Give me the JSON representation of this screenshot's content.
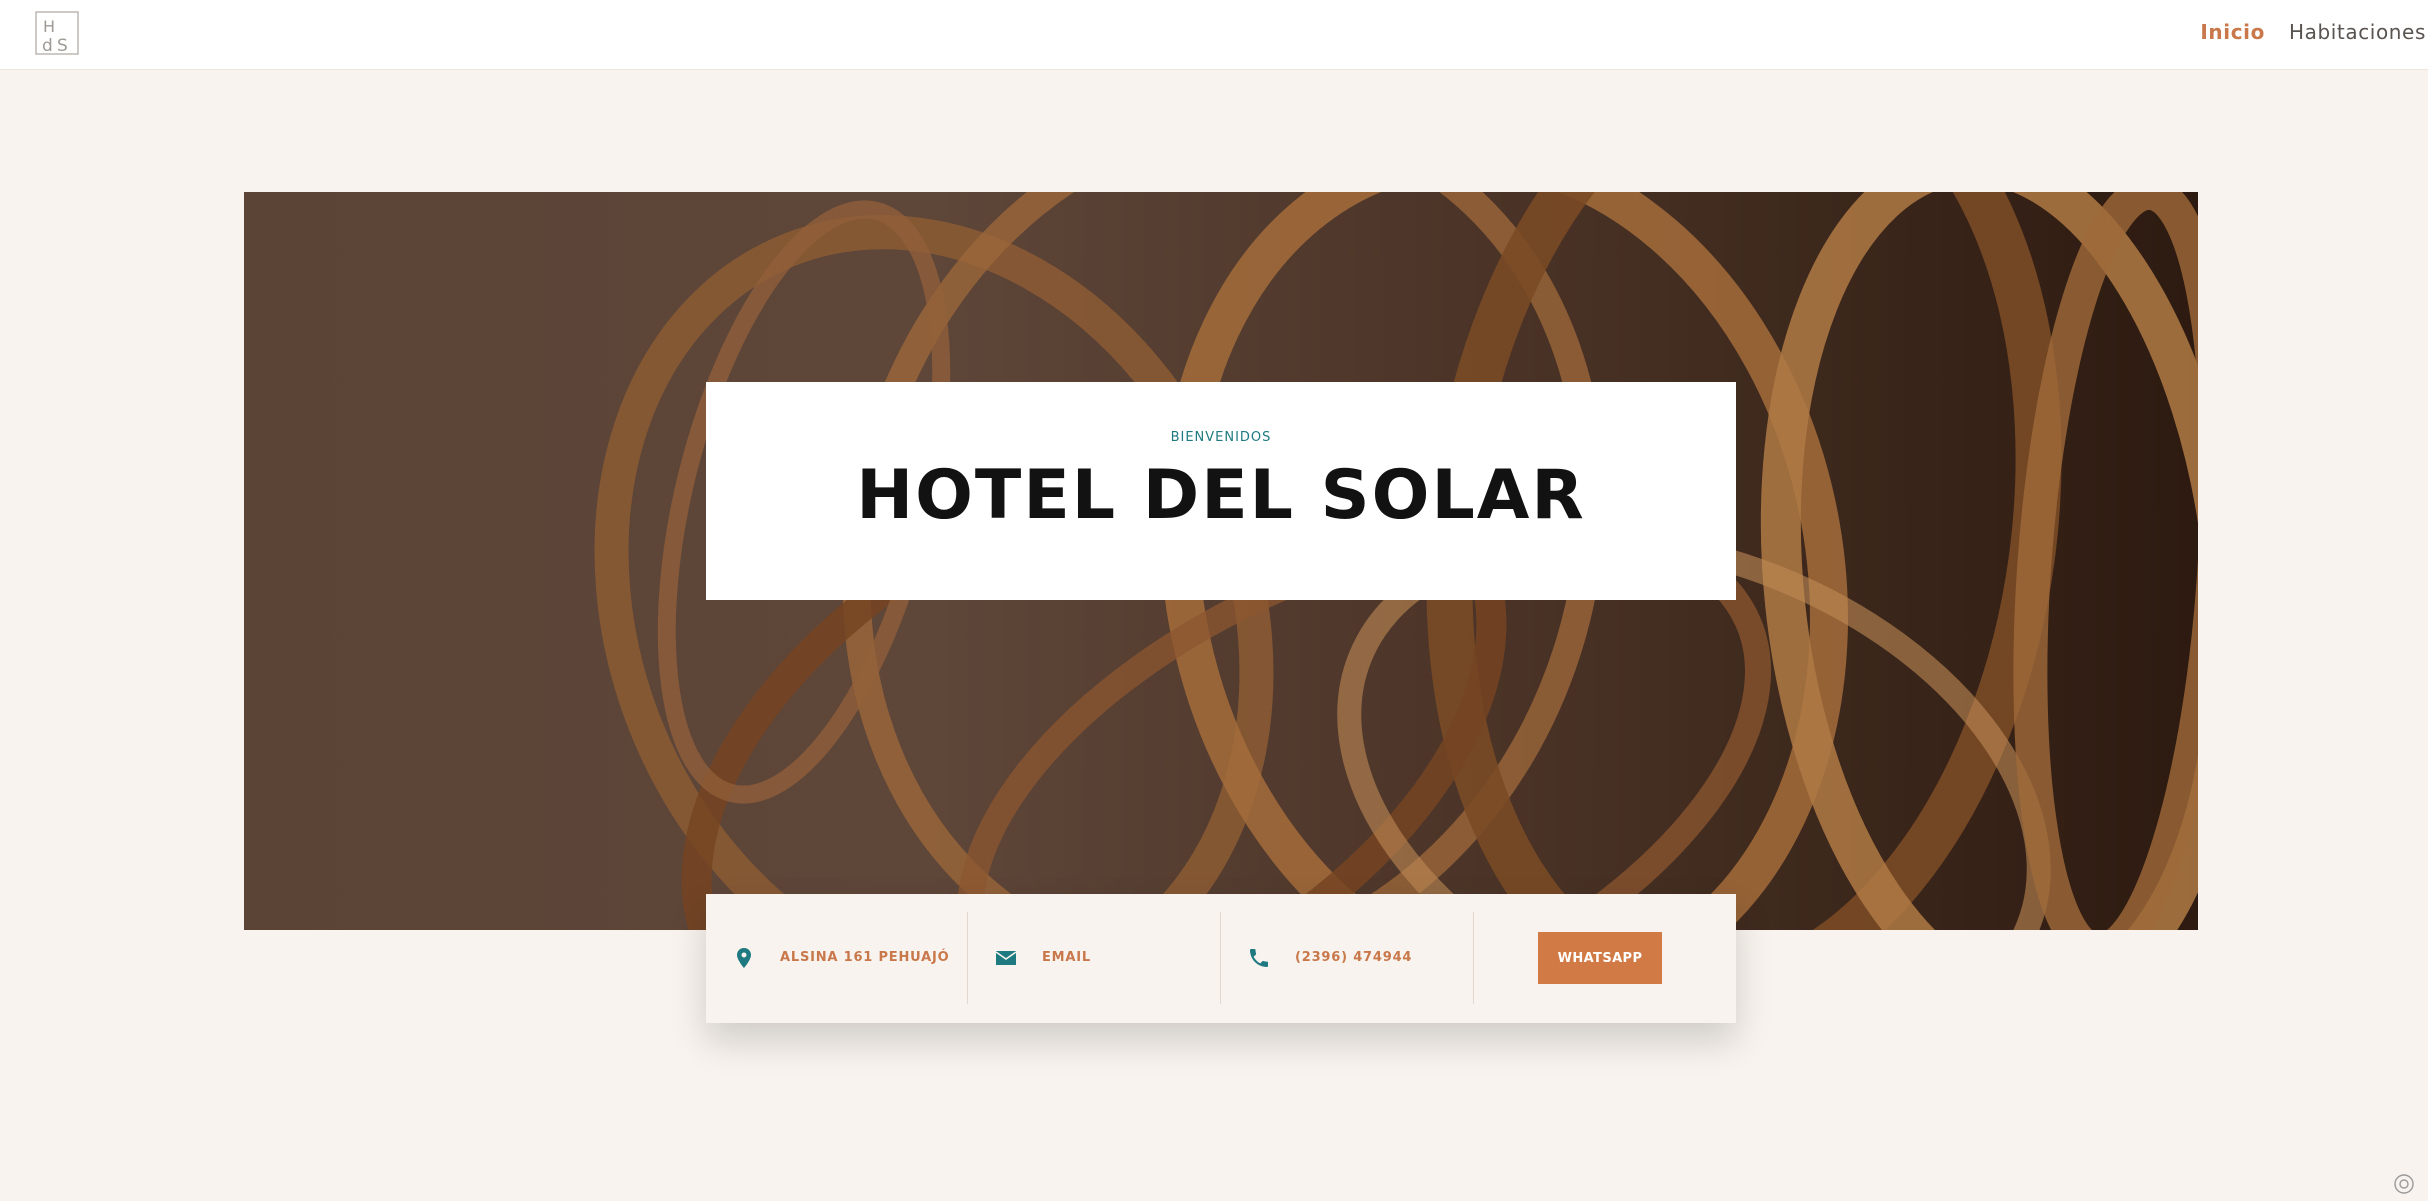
{
  "header": {
    "logo": {
      "icon": "hds-logo-icon",
      "text": "HdS"
    },
    "nav": [
      {
        "label": "Inicio",
        "active": true
      },
      {
        "label": "Habitaciones",
        "active": false
      }
    ]
  },
  "hero": {
    "eyebrow": "BIENVENIDOS",
    "title": "HOTEL DEL SOLAR"
  },
  "info": {
    "address": {
      "icon": "location-pin-icon",
      "text": "ALSINA 161 PEHUAJÓ"
    },
    "email": {
      "icon": "envelope-icon",
      "text": "EMAIL"
    },
    "phone": {
      "icon": "phone-icon",
      "text": "(2396) 474944"
    },
    "whatsapp_label": "WHATSAPP"
  },
  "colors": {
    "accent": "#c8784a",
    "button": "#d27a45",
    "teal": "#1e7a80",
    "background": "#f8f3ee"
  }
}
